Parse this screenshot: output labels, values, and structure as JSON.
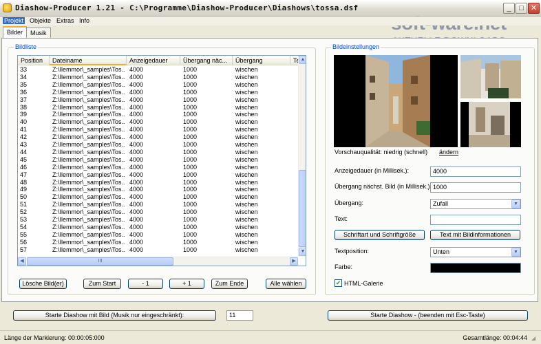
{
  "window": {
    "title": "Diashow-Producer   1.21 - C:\\Programme\\Diashow-Producer\\Diashows\\tossa.dsf",
    "minimize_glyph": "_",
    "maximize_glyph": "□",
    "close_glyph": "✕"
  },
  "watermark": {
    "brand": "soft-ware.net",
    "tagline": "AKTUELLE DOWNLOADS"
  },
  "menu": [
    "Projekt",
    "Objekte",
    "Extras",
    "Info"
  ],
  "tabs": [
    "Bilder",
    "Musik"
  ],
  "bildliste": {
    "title": "Bildliste",
    "columns": [
      "Position",
      "Dateiname",
      "Anzeigedauer",
      "Übergang näc...",
      "Übergang",
      "Te"
    ],
    "rows": [
      [
        "33",
        "Z:\\Ilemmor\\_samples\\Tos...",
        "4000",
        "1000",
        "wischen"
      ],
      [
        "34",
        "Z:\\Ilemmor\\_samples\\Tos...",
        "4000",
        "1000",
        "wischen"
      ],
      [
        "35",
        "Z:\\Ilemmor\\_samples\\Tos...",
        "4000",
        "1000",
        "wischen"
      ],
      [
        "36",
        "Z:\\Ilemmor\\_samples\\Tos...",
        "4000",
        "1000",
        "wischen"
      ],
      [
        "37",
        "Z:\\Ilemmor\\_samples\\Tos...",
        "4000",
        "1000",
        "wischen"
      ],
      [
        "38",
        "Z:\\Ilemmor\\_samples\\Tos...",
        "4000",
        "1000",
        "wischen"
      ],
      [
        "39",
        "Z:\\Ilemmor\\_samples\\Tos...",
        "4000",
        "1000",
        "wischen"
      ],
      [
        "40",
        "Z:\\Ilemmor\\_samples\\Tos...",
        "4000",
        "1000",
        "wischen"
      ],
      [
        "41",
        "Z:\\Ilemmor\\_samples\\Tos...",
        "4000",
        "1000",
        "wischen"
      ],
      [
        "42",
        "Z:\\Ilemmor\\_samples\\Tos...",
        "4000",
        "1000",
        "wischen"
      ],
      [
        "43",
        "Z:\\Ilemmor\\_samples\\Tos...",
        "4000",
        "1000",
        "wischen"
      ],
      [
        "44",
        "Z:\\Ilemmor\\_samples\\Tos...",
        "4000",
        "1000",
        "wischen"
      ],
      [
        "45",
        "Z:\\Ilemmor\\_samples\\Tos...",
        "4000",
        "1000",
        "wischen"
      ],
      [
        "46",
        "Z:\\Ilemmor\\_samples\\Tos...",
        "4000",
        "1000",
        "wischen"
      ],
      [
        "47",
        "Z:\\Ilemmor\\_samples\\Tos...",
        "4000",
        "1000",
        "wischen"
      ],
      [
        "48",
        "Z:\\Ilemmor\\_samples\\Tos...",
        "4000",
        "1000",
        "wischen"
      ],
      [
        "49",
        "Z:\\Ilemmor\\_samples\\Tos...",
        "4000",
        "1000",
        "wischen"
      ],
      [
        "50",
        "Z:\\Ilemmor\\_samples\\Tos...",
        "4000",
        "1000",
        "wischen"
      ],
      [
        "51",
        "Z:\\Ilemmor\\_samples\\Tos...",
        "4000",
        "1000",
        "wischen"
      ],
      [
        "52",
        "Z:\\Ilemmor\\_samples\\Tos...",
        "4000",
        "1000",
        "wischen"
      ],
      [
        "53",
        "Z:\\Ilemmor\\_samples\\Tos...",
        "4000",
        "1000",
        "wischen"
      ],
      [
        "54",
        "Z:\\Ilemmor\\_samples\\Tos...",
        "4000",
        "1000",
        "wischen"
      ],
      [
        "55",
        "Z:\\Ilemmor\\_samples\\Tos...",
        "4000",
        "1000",
        "wischen"
      ],
      [
        "56",
        "Z:\\Ilemmor\\_samples\\Tos...",
        "4000",
        "1000",
        "wischen"
      ],
      [
        "57",
        "Z:\\Ilemmor\\_samples\\Tos...",
        "4000",
        "1000",
        "wischen"
      ]
    ],
    "hscroll_grip": "III",
    "buttons": [
      "Lösche Bild(er)",
      "Zum Start",
      "- 1",
      "+ 1",
      "Zum Ende",
      "Alle wählen"
    ]
  },
  "bildeinstellungen": {
    "title": "Bildeinstellungen",
    "preview_quality": "Vorschauqualität: niedrig (schnell)",
    "change_link": "ändern",
    "anzeigedauer_label": "Anzeigedauer (in Millisek.):",
    "anzeigedauer_value": "4000",
    "uebergang_dauer_label": "Übergang nächst. Bild (in Millisek.):",
    "uebergang_dauer_value": "1000",
    "uebergang_label": "Übergang:",
    "uebergang_value": "Zufall",
    "text_label": "Text:",
    "text_value": "",
    "font_button": "Schriftart und Schriftgröße",
    "info_button": "Text mit Bildinformationen",
    "textposition_label": "Textposition:",
    "textposition_value": "Unten",
    "farbe_label": "Farbe:",
    "farbe_color": "#000000",
    "html_galerie_label": "HTML-Galerie",
    "html_galerie_checked": true
  },
  "bottom": {
    "start_with_image": "Starte Diashow mit Bild (Musik nur eingeschränkt):",
    "start_image_number": "11",
    "start_show": "Starte Diashow    -    (beenden mit Esc-Taste)"
  },
  "status": {
    "selection_length": "Länge der Markierung: 00:00:05:000",
    "total_length": "Gesamtlänge: 00:04:44"
  },
  "colors": {
    "accent": "#0046d5",
    "sort_indicator": "#f9a62f",
    "tab_highlight": "#f0b030"
  }
}
